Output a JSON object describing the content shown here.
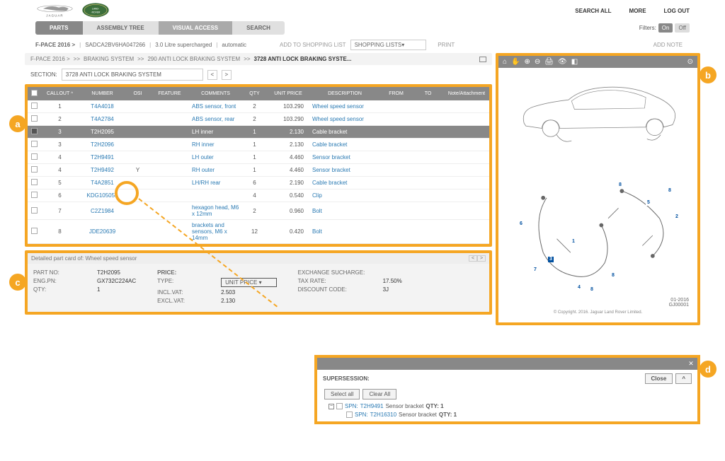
{
  "header": {
    "search_all": "SEARCH ALL",
    "more": "MORE",
    "logout": "LOG OUT"
  },
  "tabs": {
    "parts": "PARTS",
    "assembly": "ASSEMBLY TREE",
    "visual": "VISUAL ACCESS",
    "search": "SEARCH"
  },
  "filters": {
    "label": "Filters:",
    "on": "On",
    "off": "Off"
  },
  "vehicle": {
    "model": "F-PACE 2016 >",
    "vin": "SADCA2BV6HA047266",
    "engine": "3.0 Litre supercharged",
    "trans": "automatic",
    "add_list": "ADD TO SHOPPING LIST",
    "shopping_lists": "SHOPPING LISTS",
    "print": "PRINT",
    "add_note": "ADD NOTE"
  },
  "breadcrumb": {
    "p1": "F-PACE 2016 >",
    "p2": "BRAKING SYSTEM",
    "p3": "290 ANTI LOCK BRAKING SYSTEM",
    "p4": "3728 ANTI LOCK BRAKING SYSTE..."
  },
  "section": {
    "label": "SECTION:",
    "value": "3728 ANTI LOCK BRAKING SYSTEM"
  },
  "table": {
    "headers": {
      "callout": "CALLOUT",
      "number": "NUMBER",
      "osi": "OSI",
      "feature": "FEATURE",
      "comments": "COMMENTS",
      "qty": "QTY",
      "unit_price": "UNIT PRICE",
      "description": "DESCRIPTION",
      "from": "FROM",
      "to": "TO",
      "note": "Note/Attachment"
    },
    "rows": [
      {
        "callout": "1",
        "number": "T4A4018",
        "osi": "",
        "comments": "ABS sensor, front",
        "qty": "2",
        "price": "103.290",
        "desc": "Wheel speed sensor"
      },
      {
        "callout": "2",
        "number": "T4A2784",
        "osi": "",
        "comments": "ABS sensor, rear",
        "qty": "2",
        "price": "103.290",
        "desc": "Wheel speed sensor"
      },
      {
        "callout": "3",
        "number": "T2H2095",
        "osi": "",
        "comments": "LH inner",
        "qty": "1",
        "price": "2.130",
        "desc": "Cable bracket",
        "selected": true
      },
      {
        "callout": "3",
        "number": "T2H2096",
        "osi": "",
        "comments": "RH inner",
        "qty": "1",
        "price": "2.130",
        "desc": "Cable bracket"
      },
      {
        "callout": "4",
        "number": "T2H9491",
        "osi": "",
        "comments": "LH outer",
        "qty": "1",
        "price": "4.460",
        "desc": "Sensor bracket"
      },
      {
        "callout": "4",
        "number": "T2H9492",
        "osi": "Y",
        "comments": "RH outer",
        "qty": "1",
        "price": "4.460",
        "desc": "Sensor bracket"
      },
      {
        "callout": "5",
        "number": "T4A2851",
        "osi": "",
        "comments": "LH/RH rear",
        "qty": "6",
        "price": "2.190",
        "desc": "Cable bracket"
      },
      {
        "callout": "6",
        "number": "KDG105053",
        "osi": "",
        "comments": "",
        "qty": "4",
        "price": "0.540",
        "desc": "Clip"
      },
      {
        "callout": "7",
        "number": "C2Z1984",
        "osi": "",
        "comments": "hexagon head, M6 x 12mm",
        "qty": "2",
        "price": "0.960",
        "desc": "Bolt"
      },
      {
        "callout": "8",
        "number": "JDE20639",
        "osi": "",
        "comments": "brackets and sensors, M6 x 14mm",
        "qty": "12",
        "price": "0.420",
        "desc": "Bolt"
      }
    ]
  },
  "detail": {
    "title": "Detailed part card of: Wheel speed sensor",
    "part_no_label": "PART NO:",
    "part_no": "T2H2095",
    "eng_pn_label": "ENG.PN:",
    "eng_pn": "GX732C224AC",
    "qty_label": "QTY:",
    "qty": "1",
    "price_label": "PRICE:",
    "type_label": "TYPE:",
    "type_value": "UNIT PRICE",
    "incl_vat_label": "INCL.VAT:",
    "incl_vat": "2.503",
    "excl_vat_label": "EXCL.VAT:",
    "excl_vat": "2.130",
    "exchange_label": "EXCHANGE SUCHARGE:",
    "tax_label": "TAX RATE:",
    "tax": "17.50%",
    "discount_label": "DISCOUNT CODE:",
    "discount": "3J"
  },
  "image": {
    "copyright": "© Copyright. 2016. Jaguar Land Rover Limited.",
    "date": "01-2016",
    "ref": "GJ00001"
  },
  "popup": {
    "supersession": "SUPERSESSION:",
    "close": "Close",
    "select_all": "Select all",
    "clear_all": "Clear All",
    "spn1_prefix": "SPN:",
    "spn1_num": "T2H9491",
    "spn1_desc": "Sensor bracket",
    "spn1_qty": "QTY: 1",
    "spn2_prefix": "SPN:",
    "spn2_num": "T2H16310",
    "spn2_desc": "Sensor bracket",
    "spn2_qty": "QTY: 1"
  }
}
